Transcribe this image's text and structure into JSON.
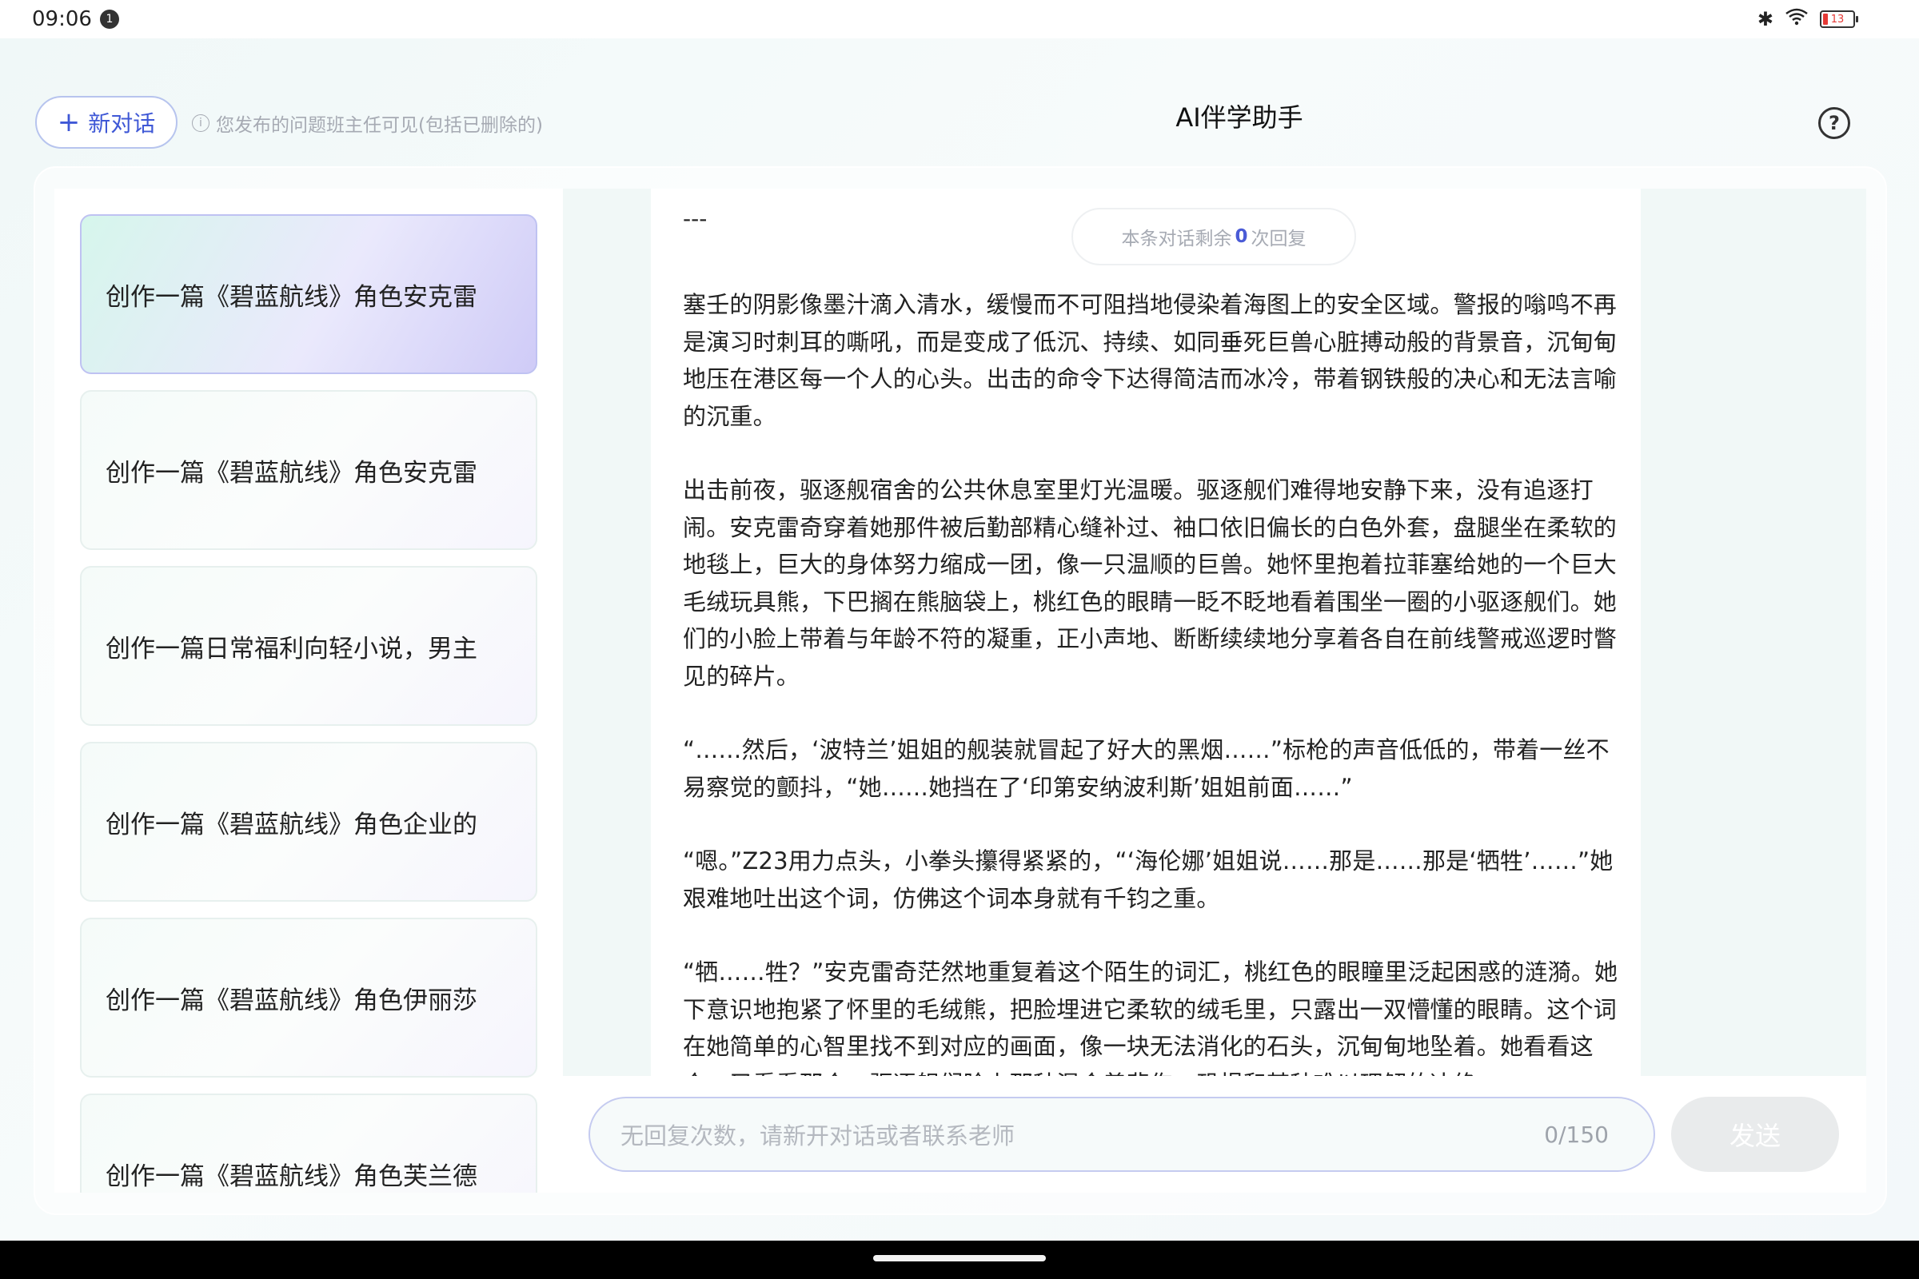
{
  "status_bar": {
    "time": "09:06",
    "notification_count": "1",
    "battery_level": "13"
  },
  "header": {
    "new_chat_label": "新对话",
    "notice": "您发布的问题班主任可见(包括已删除的)",
    "title": "AI伴学助手"
  },
  "sidebar": {
    "items": [
      {
        "label": "创作一篇《碧蓝航线》角色安克雷",
        "active": true
      },
      {
        "label": "创作一篇《碧蓝航线》角色安克雷",
        "active": false
      },
      {
        "label": "创作一篇日常福利向轻小说，男主",
        "active": false
      },
      {
        "label": "创作一篇《碧蓝航线》角色企业的",
        "active": false
      },
      {
        "label": "创作一篇《碧蓝航线》角色伊丽莎",
        "active": false
      },
      {
        "label": "创作一篇《碧蓝航线》角色芙兰德",
        "active": false
      }
    ]
  },
  "chat": {
    "remaining_prefix": "本条对话剩余",
    "remaining_count": "0",
    "remaining_suffix": "次回复",
    "divider": "---",
    "paragraphs": [
      "塞壬的阴影像墨汁滴入清水，缓慢而不可阻挡地侵染着海图上的安全区域。警报的嗡鸣不再是演习时刺耳的嘶吼，而是变成了低沉、持续、如同垂死巨兽心脏搏动般的背景音，沉甸甸地压在港区每一个人的心头。出击的命令下达得简洁而冰冷，带着钢铁般的决心和无法言喻的沉重。",
      "出击前夜，驱逐舰宿舍的公共休息室里灯光温暖。驱逐舰们难得地安静下来，没有追逐打闹。安克雷奇穿着她那件被后勤部精心缝补过、袖口依旧偏长的白色外套，盘腿坐在柔软的地毯上，巨大的身体努力缩成一团，像一只温顺的巨兽。她怀里抱着拉菲塞给她的一个巨大毛绒玩具熊，下巴搁在熊脑袋上，桃红色的眼睛一眨不眨地看着围坐一圈的小驱逐舰们。她们的小脸上带着与年龄不符的凝重，正小声地、断断续续地分享着各自在前线警戒巡逻时瞥见的碎片。",
      "“……然后，‘波特兰’姐姐的舰装就冒起了好大的黑烟……”标枪的声音低低的，带着一丝不易察觉的颤抖，“她……她挡在了‘印第安纳波利斯’姐姐前面……”",
      "“嗯。”Z23用力点头，小拳头攥得紧紧的，“‘海伦娜’姐姐说……那是……那是‘牺牲’……”她艰难地吐出这个词，仿佛这个词本身就有千钧之重。",
      "“牺……牲？”安克雷奇茫然地重复着这个陌生的词汇，桃红色的眼瞳里泛起困惑的涟漪。她下意识地抱紧了怀里的毛绒熊，把脸埋进它柔软的绒毛里，只露出一双懵懂的眼睛。这个词在她简单的心智里找不到对应的画面，像一块无法消化的石头，沉甸甸地坠着。她看看这个，又看看那个，驱逐舰们脸上那种混合着悲伤、恐惧和某种难以理解的决绝"
    ]
  },
  "input": {
    "placeholder": "无回复次数，请新开对话或者联系老师",
    "counter": "0/150",
    "send_label": "发送"
  }
}
